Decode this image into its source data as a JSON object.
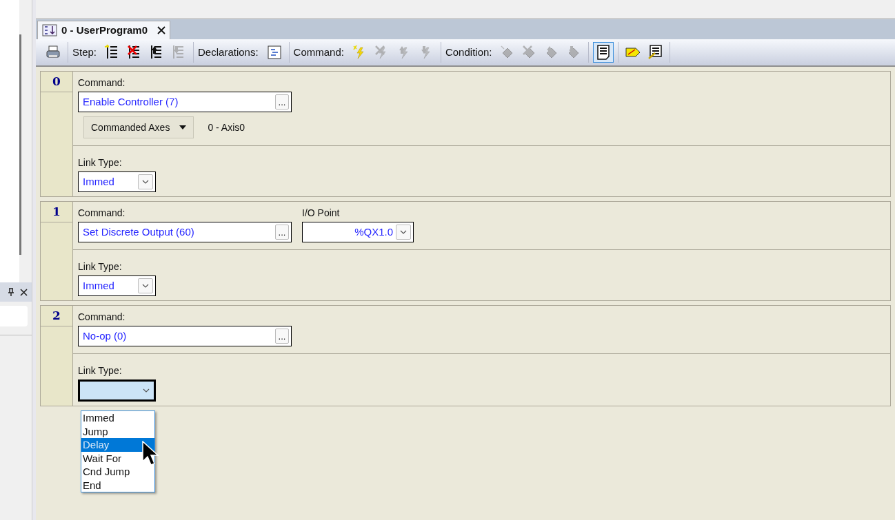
{
  "tab": {
    "title": "0 - UserProgram0",
    "selected": true
  },
  "toolbar": {
    "groups": [
      {
        "icons": [
          {
            "kind": "print",
            "disabled": false
          }
        ]
      },
      {
        "label": "Step:",
        "icons": [
          {
            "kind": "step-new",
            "disabled": false
          },
          {
            "kind": "step-delete",
            "disabled": false
          },
          {
            "kind": "step-up",
            "disabled": false
          },
          {
            "kind": "step-down",
            "disabled": true
          }
        ]
      },
      {
        "label": "Declarations:",
        "icons": [
          {
            "kind": "declarations",
            "disabled": false
          }
        ]
      },
      {
        "label": "Command:",
        "icons": [
          {
            "kind": "cmd-new",
            "disabled": false
          },
          {
            "kind": "cmd-delete",
            "disabled": true
          },
          {
            "kind": "cmd-up",
            "disabled": true
          },
          {
            "kind": "cmd-down",
            "disabled": true
          }
        ]
      },
      {
        "label": "Condition:",
        "icons": [
          {
            "kind": "cond-new",
            "disabled": true
          },
          {
            "kind": "cond-delete",
            "disabled": true
          },
          {
            "kind": "cond-up",
            "disabled": true
          },
          {
            "kind": "cond-down",
            "disabled": true
          }
        ]
      },
      {
        "icons": [
          {
            "kind": "document",
            "disabled": false,
            "selected": true
          }
        ]
      },
      {
        "icons": [
          {
            "kind": "tag",
            "disabled": false,
            "selected": false
          },
          {
            "kind": "document-edit",
            "disabled": false,
            "selected": false
          }
        ]
      }
    ]
  },
  "steps": [
    {
      "number": "0",
      "command_label": "Command:",
      "command": "Enable Controller (7)",
      "ellipsis": "...",
      "axes_button": "Commanded Axes",
      "axes_value": "0 - Axis0",
      "link_label": "Link Type:",
      "link_type": "Immed",
      "link_open": false
    },
    {
      "number": "1",
      "command_label": "Command:",
      "command": "Set Discrete Output (60)",
      "ellipsis": "...",
      "io_label": "I/O Point",
      "io_value": "%QX1.0",
      "link_label": "Link Type:",
      "link_type": "Immed",
      "link_open": false
    },
    {
      "number": "2",
      "command_label": "Command:",
      "command": "No-op (0)",
      "ellipsis": "...",
      "link_label": "Link Type:",
      "link_open": true,
      "link_options": [
        {
          "label": "Immed",
          "selected": false
        },
        {
          "label": "Jump",
          "selected": false
        },
        {
          "label": "Delay",
          "selected": true
        },
        {
          "label": "Wait For",
          "selected": false
        },
        {
          "label": "Cnd Jump",
          "selected": false
        },
        {
          "label": "End",
          "selected": false
        }
      ]
    }
  ]
}
